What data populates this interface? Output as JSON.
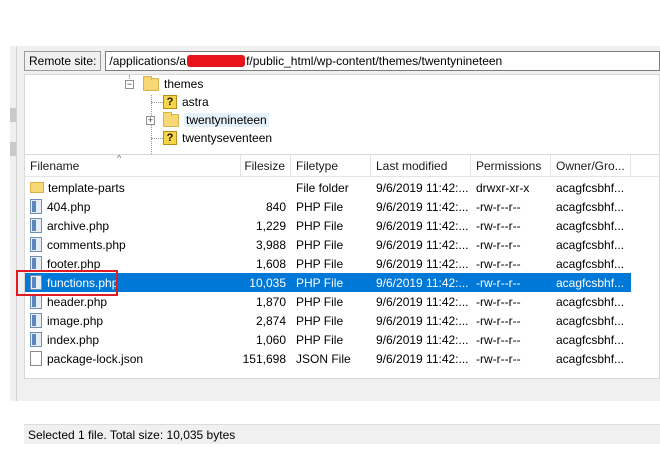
{
  "remote_site": {
    "label": "Remote site:",
    "path_prefix": "/applications/a",
    "path_suffix": "f/public_html/wp-content/themes/twentynineteen"
  },
  "tree": {
    "items": [
      {
        "label": "themes",
        "icon": "folder-icon",
        "expander": "−"
      },
      {
        "label": "astra",
        "icon": "question-folder-icon"
      },
      {
        "label": "twentynineteen",
        "icon": "folder-icon",
        "expander": "+"
      },
      {
        "label": "twentyseventeen",
        "icon": "question-folder-icon"
      }
    ]
  },
  "columns": {
    "filename": "Filename",
    "filesize": "Filesize",
    "filetype": "Filetype",
    "last_modified": "Last modified",
    "permissions": "Permissions",
    "owner": "Owner/Gro..."
  },
  "files": [
    {
      "name": "template-parts",
      "size": "",
      "type": "File folder",
      "modified": "9/6/2019 11:42:...",
      "perms": "drwxr-xr-x",
      "owner": "acagfcsbhf...",
      "icon": "folder"
    },
    {
      "name": "404.php",
      "size": "840",
      "type": "PHP File",
      "modified": "9/6/2019 11:42:...",
      "perms": "-rw-r--r--",
      "owner": "acagfcsbhf...",
      "icon": "php"
    },
    {
      "name": "archive.php",
      "size": "1,229",
      "type": "PHP File",
      "modified": "9/6/2019 11:42:...",
      "perms": "-rw-r--r--",
      "owner": "acagfcsbhf...",
      "icon": "php"
    },
    {
      "name": "comments.php",
      "size": "3,988",
      "type": "PHP File",
      "modified": "9/6/2019 11:42:...",
      "perms": "-rw-r--r--",
      "owner": "acagfcsbhf...",
      "icon": "php"
    },
    {
      "name": "footer.php",
      "size": "1,608",
      "type": "PHP File",
      "modified": "9/6/2019 11:42:...",
      "perms": "-rw-r--r--",
      "owner": "acagfcsbhf...",
      "icon": "php"
    },
    {
      "name": "functions.php",
      "size": "10,035",
      "type": "PHP File",
      "modified": "9/6/2019 11:42:...",
      "perms": "-rw-r--r--",
      "owner": "acagfcsbhf...",
      "icon": "php",
      "selected": true
    },
    {
      "name": "header.php",
      "size": "1,870",
      "type": "PHP File",
      "modified": "9/6/2019 11:42:...",
      "perms": "-rw-r--r--",
      "owner": "acagfcsbhf...",
      "icon": "php"
    },
    {
      "name": "image.php",
      "size": "2,874",
      "type": "PHP File",
      "modified": "9/6/2019 11:42:...",
      "perms": "-rw-r--r--",
      "owner": "acagfcsbhf...",
      "icon": "php"
    },
    {
      "name": "index.php",
      "size": "1,060",
      "type": "PHP File",
      "modified": "9/6/2019 11:42:...",
      "perms": "-rw-r--r--",
      "owner": "acagfcsbhf...",
      "icon": "php"
    },
    {
      "name": "package-lock.json",
      "size": "151,698",
      "type": "JSON File",
      "modified": "9/6/2019 11:42:...",
      "perms": "-rw-r--r--",
      "owner": "acagfcsbhf...",
      "icon": "json"
    }
  ],
  "status": "Selected 1 file. Total size: 10,035 bytes",
  "colors": {
    "selection": "#0078d7",
    "annotation": "#e11b22"
  }
}
